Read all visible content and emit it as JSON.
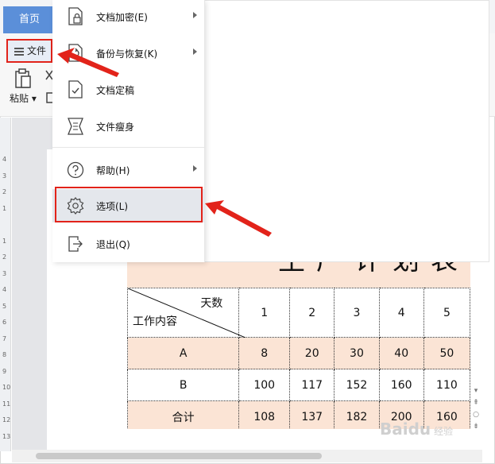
{
  "tabs": {
    "home": "首页"
  },
  "toolbar": {
    "file_label": "文件",
    "paste_label": "粘贴"
  },
  "menu": {
    "items": [
      {
        "label": "文档加密(E)",
        "has_submenu": true,
        "icon": "lock-document-icon"
      },
      {
        "label": "备份与恢复(K)",
        "has_submenu": true,
        "icon": "backup-restore-icon"
      },
      {
        "label": "文档定稿",
        "has_submenu": false,
        "icon": "finalize-document-icon"
      },
      {
        "label": "文件瘦身",
        "has_submenu": false,
        "icon": "compress-file-icon"
      },
      {
        "label": "帮助(H)",
        "has_submenu": true,
        "icon": "help-icon"
      },
      {
        "label": "选项(L)",
        "has_submenu": false,
        "icon": "gear-icon",
        "highlighted": true
      },
      {
        "label": "退出(Q)",
        "has_submenu": false,
        "icon": "exit-icon"
      }
    ]
  },
  "ruler": {
    "marks": [
      "4",
      "3",
      "2",
      "1",
      "",
      "1",
      "2",
      "3",
      "4",
      "5",
      "6",
      "7",
      "8",
      "9",
      "10",
      "11",
      "12",
      "13"
    ]
  },
  "table": {
    "title": "生产计划表",
    "header_top": "天数",
    "header_bottom": "工作内容",
    "columns": [
      "1",
      "2",
      "3",
      "4",
      "5"
    ],
    "rows": [
      {
        "label": "A",
        "values": [
          "8",
          "20",
          "30",
          "40",
          "50"
        ]
      },
      {
        "label": "B",
        "values": [
          "100",
          "117",
          "152",
          "160",
          "110"
        ]
      },
      {
        "label": "合计",
        "values": [
          "108",
          "137",
          "182",
          "200",
          "160"
        ]
      }
    ]
  },
  "watermark": {
    "text": "Baidu",
    "sub": "经验"
  },
  "colors": {
    "accent_red": "#e2231a",
    "home_tab": "#5b8fd9",
    "row_peach": "#fbe4d5"
  }
}
